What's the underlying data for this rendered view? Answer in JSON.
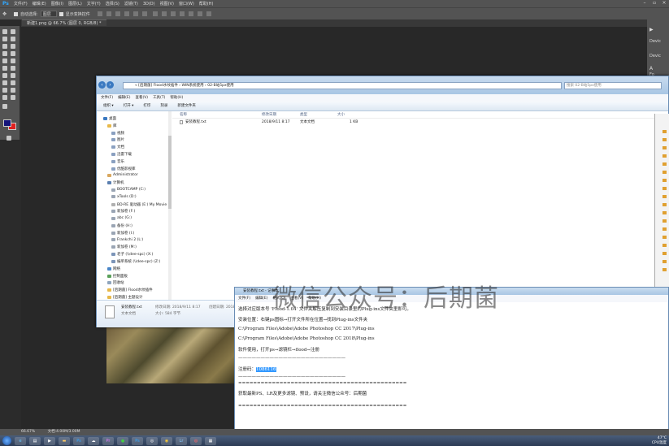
{
  "photoshop": {
    "logo": "Ps",
    "menu": [
      "文件(F)",
      "编辑(E)",
      "图像(I)",
      "图层(L)",
      "文字(Y)",
      "选择(S)",
      "滤镜(T)",
      "3D(D)",
      "视图(V)",
      "窗口(W)",
      "帮助(H)"
    ],
    "options": {
      "auto_select_label": "自动选择:",
      "auto_select_value": "图层",
      "show_transform_label": "显示变换控件"
    },
    "doc_tab": "新建1.png @ 66.7% (图层 0, RGB/8) *",
    "right_panel": [
      "Devic",
      "Fo"
    ],
    "status_zoom": "66.67%",
    "status_doc": "文档:4.00M/3.00M"
  },
  "explorer": {
    "address": "« [后期菌] Flood水纹插件 › WIN系统使用 › 02-B站5px使用",
    "search_placeholder": "搜索 02-B站5px使用",
    "menu": [
      "文件(F)",
      "编辑(E)",
      "查看(V)",
      "工具(T)",
      "帮助(H)"
    ],
    "commands": [
      "组织 ▾",
      "打开 ▾",
      "打印",
      "刻录",
      "新建文件夹"
    ],
    "nav_tree": [
      {
        "label": "桌面",
        "icon": "desktop-icon",
        "indent": 0
      },
      {
        "label": "库",
        "icon": "library-icon",
        "indent": 1
      },
      {
        "label": "视频",
        "icon": "video-icon",
        "indent": 2
      },
      {
        "label": "图片",
        "icon": "picture-icon",
        "indent": 2
      },
      {
        "label": "文档",
        "icon": "document-icon",
        "indent": 2
      },
      {
        "label": "迅雷下载",
        "icon": "download-icon",
        "indent": 2
      },
      {
        "label": "音乐",
        "icon": "music-icon",
        "indent": 2
      },
      {
        "label": "优酷影视库",
        "icon": "media-library-icon",
        "indent": 2
      },
      {
        "label": "Administrator",
        "icon": "user-icon",
        "indent": 1
      },
      {
        "label": "计算机",
        "icon": "computer-icon",
        "indent": 1
      },
      {
        "label": "BOOTCAMP (C:)",
        "icon": "drive-icon",
        "indent": 2
      },
      {
        "label": "xTools (D:)",
        "icon": "drive-icon",
        "indent": 2
      },
      {
        "label": "BD-RE 驱动器 (E:) My Movie",
        "icon": "optical-drive-icon",
        "indent": 2
      },
      {
        "label": "新加卷 (F:)",
        "icon": "drive-icon",
        "indent": 2
      },
      {
        "label": "abc (G:)",
        "icon": "drive-icon",
        "indent": 2
      },
      {
        "label": "备份 (H:)",
        "icon": "drive-icon",
        "indent": 2
      },
      {
        "label": "新加卷 (I:)",
        "icon": "drive-icon",
        "indent": 2
      },
      {
        "label": "Frankchi 2 (L:)",
        "icon": "drive-icon",
        "indent": 2
      },
      {
        "label": "新加卷 (M:)",
        "icon": "drive-icon",
        "indent": 2
      },
      {
        "label": "老子 (\\\\dee-spc) (X:)",
        "icon": "network-drive-icon",
        "indent": 2
      },
      {
        "label": "编单系统 (\\\\dee-spc) (Z:)",
        "icon": "network-drive-icon",
        "indent": 2
      },
      {
        "label": "网络",
        "icon": "network-icon",
        "indent": 1
      },
      {
        "label": "控制面板",
        "icon": "control-panel-icon",
        "indent": 1
      },
      {
        "label": "回收站",
        "icon": "recycle-bin-icon",
        "indent": 1
      },
      {
        "label": "[后期菌] Flood水纹插件",
        "icon": "folder-icon",
        "indent": 1
      },
      {
        "label": "[后期菌] 主题设计",
        "icon": "folder-icon",
        "indent": 1
      }
    ],
    "columns": {
      "name": "名称",
      "date": "修改日期",
      "type": "类型",
      "size": "大小"
    },
    "files": [
      {
        "name": "安装教程.txt",
        "date": "2018/9/11 8:17",
        "type": "文本文档",
        "size": "1 KB"
      }
    ],
    "details": {
      "name": "安装教程.txt",
      "modified": "修改日期: 2018/9/11 8:17",
      "type": "文本文档",
      "size": "大小: 584 字节",
      "created": "创建日期: 2018/9/11 8:18"
    }
  },
  "notepad": {
    "title": "安装教程.txt - 记事本",
    "menu": [
      "文件(F)",
      "编辑(E)",
      "格式(O)",
      "查看(V)",
      "帮助(H)"
    ],
    "lines": [
      "选择对应版本号 'Flood-1.04' 文件夹解压复制到安装目录里的Plug-ins文件夹里即可。",
      "安装位置：右键ps图标→打开文件所在位置→找到Plug-ins文件夹",
      "C:\\Program Files\\Adobe\\Adobe Photoshop CC 2017\\Plug-ins",
      "C:\\Program Files\\Adobe\\Adobe Photoshop CC 2018\\Plug-ins",
      "软件使用，打开ps→滤镜栏→flood→注册",
      "————————————————————————",
      "注册码：",
      "————————————————————————",
      "=============================================",
      "获取最新PS、LR及更多滤镜、预设，请关注微信公众号：后期菌",
      "============================================="
    ],
    "registration_code": "1086116",
    "watermark": "微信公众号：后期菌"
  },
  "taskbar": {
    "apps": [
      "ie",
      "explorer",
      "media",
      "folder",
      "ps",
      "baidu",
      "pr",
      "wechat",
      "ps2",
      "media2",
      "chrome",
      "lr",
      "browser",
      "notepad"
    ],
    "tray_temp": "47°C",
    "tray_text": "CPU温度"
  }
}
